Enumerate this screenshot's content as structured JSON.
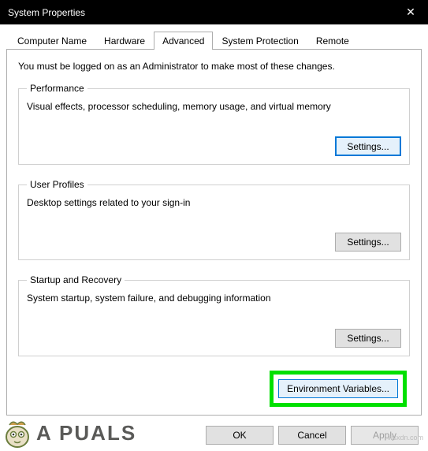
{
  "title": "System Properties",
  "close_icon": "✕",
  "tabs": [
    {
      "label": "Computer Name",
      "active": false
    },
    {
      "label": "Hardware",
      "active": false
    },
    {
      "label": "Advanced",
      "active": true
    },
    {
      "label": "System Protection",
      "active": false
    },
    {
      "label": "Remote",
      "active": false
    }
  ],
  "intro": "You must be logged on as an Administrator to make most of these changes.",
  "groups": {
    "performance": {
      "legend": "Performance",
      "desc": "Visual effects, processor scheduling, memory usage, and virtual memory",
      "button": "Settings...",
      "highlighted": true
    },
    "user_profiles": {
      "legend": "User Profiles",
      "desc": "Desktop settings related to your sign-in",
      "button": "Settings..."
    },
    "startup": {
      "legend": "Startup and Recovery",
      "desc": "System startup, system failure, and debugging information",
      "button": "Settings..."
    }
  },
  "env_button": "Environment Variables...",
  "bottom": {
    "ok": "OK",
    "cancel": "Cancel",
    "apply": "Apply",
    "apply_enabled": false
  },
  "watermark": "wsxdn.com",
  "brand": {
    "prefix": "A",
    "mid": "   ",
    "suffix": "PUALS"
  }
}
